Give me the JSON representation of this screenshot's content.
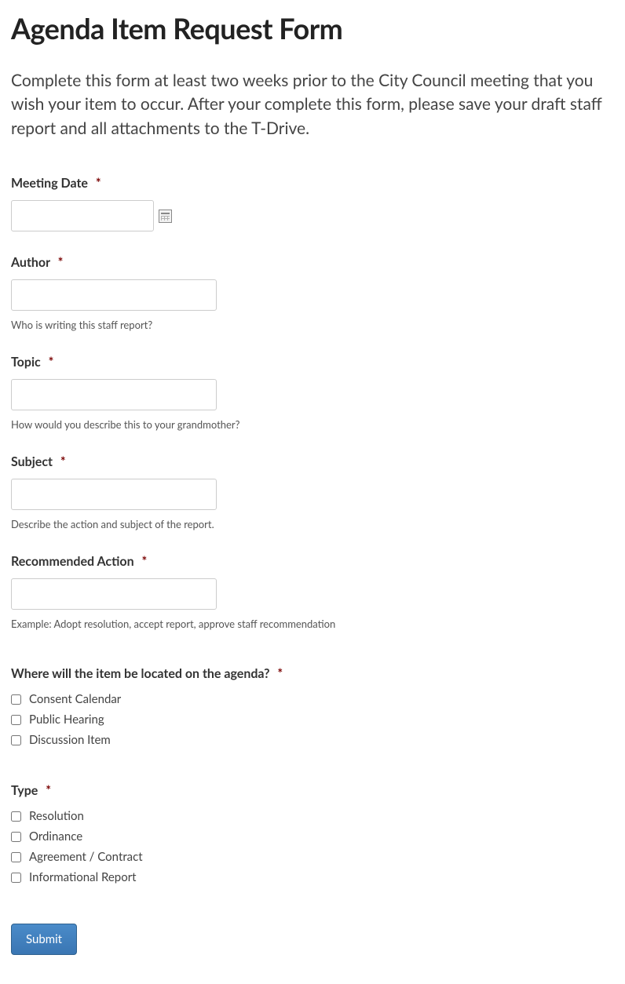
{
  "title": "Agenda Item Request Form",
  "description": "Complete this form at least two weeks prior to the City Council meeting that you wish your item to occur. After your complete this form, please save your draft staff report and all attachments to the T-Drive.",
  "required_marker": "*",
  "fields": {
    "meeting_date": {
      "label": "Meeting Date",
      "value": ""
    },
    "author": {
      "label": "Author",
      "value": "",
      "helper": "Who is writing this staff report?"
    },
    "topic": {
      "label": "Topic",
      "value": "",
      "helper": "How would you describe this to your grandmother?"
    },
    "subject": {
      "label": "Subject",
      "value": "",
      "helper": "Describe the action and subject of the report."
    },
    "recommended_action": {
      "label": "Recommended Action",
      "value": "",
      "helper": "Example: Adopt resolution, accept report, approve staff recommendation"
    },
    "location": {
      "label": "Where will the item be located on the agenda?",
      "options": [
        "Consent Calendar",
        "Public Hearing",
        "Discussion Item"
      ]
    },
    "type": {
      "label": "Type",
      "options": [
        "Resolution",
        "Ordinance",
        "Agreement / Contract",
        "Informational Report"
      ]
    }
  },
  "submit_label": "Submit"
}
